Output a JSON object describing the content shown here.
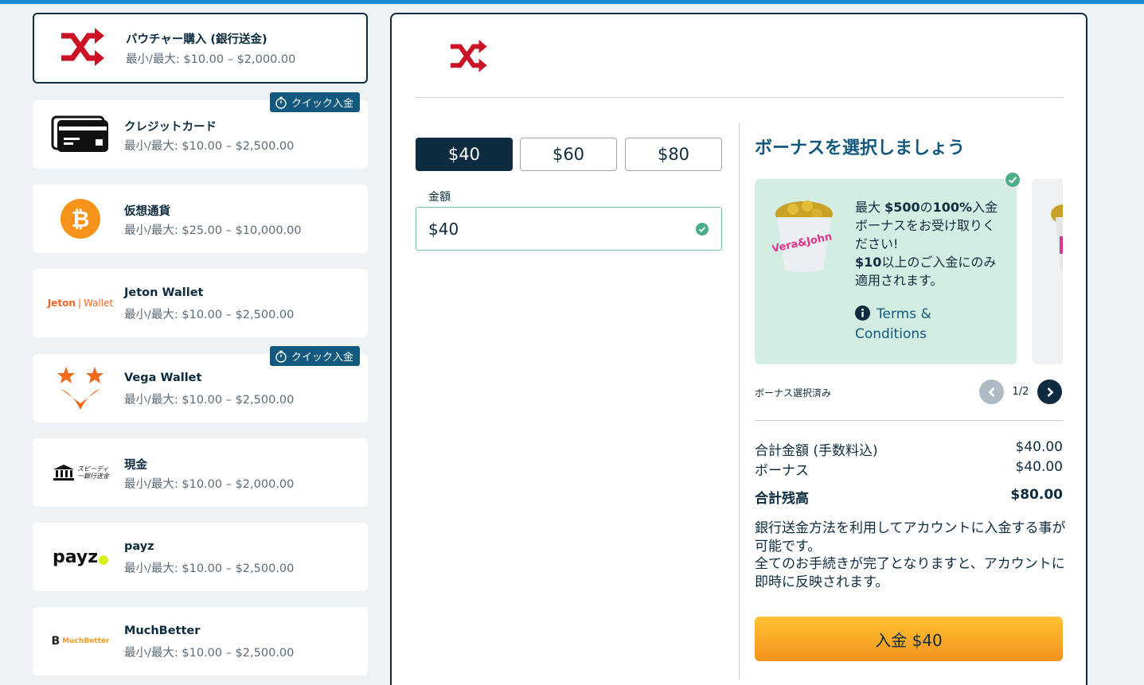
{
  "methods": [
    {
      "name": "バウチャー購入 (銀行送金)",
      "limit": "最小/最大: $10.00 – $2,000.00",
      "icon": "shuffle-icon",
      "selected": true
    },
    {
      "name": "クレジットカード",
      "limit": "最小/最大: $10.00 – $2,500.00",
      "icon": "credit-card-icon",
      "badge": "クイック入金"
    },
    {
      "name": "仮想通貨",
      "limit": "最小/最大: $25.00 – $10,000.00",
      "icon": "bitcoin-icon"
    },
    {
      "name": "Jeton Wallet",
      "limit": "最小/最大: $10.00 – $2,500.00",
      "icon": "jeton-wallet-logo",
      "logo_text_a": "Jeton",
      "logo_text_b": "Wallet"
    },
    {
      "name": "Vega Wallet",
      "limit": "最小/最大: $10.00 – $2,500.00",
      "icon": "vega-wallet-logo",
      "badge": "クイック入金"
    },
    {
      "name": "現金",
      "limit": "最小/最大: $10.00 – $2,000.00",
      "icon": "speedy-bank-transfer-logo",
      "logo_text": "スピーディー銀行送金"
    },
    {
      "name": "payz",
      "limit": "最小/最大: $10.00 – $2,500.00",
      "icon": "payz-logo",
      "logo_text": "payz"
    },
    {
      "name": "MuchBetter",
      "limit": "最小/最大: $10.00 – $2,500.00",
      "icon": "muchbetter-logo",
      "logo_text": "MuchBetter"
    }
  ],
  "amounts": [
    "$40",
    "$60",
    "$80"
  ],
  "amount_label": "金額",
  "amount_value": "$40",
  "bonus": {
    "title": "ボーナスを選択しましょう",
    "line_pre": "最大 ",
    "line_bold1": "$500",
    "line_mid": "の",
    "line_bold2": "100%",
    "line_post": "入金ボーナスをお受け取りください!",
    "line2_bold": "$10",
    "line2_post": "以上のご入金にのみ適用されます。",
    "terms": "Terms & Conditions",
    "selected_label": "ボーナス選択済み",
    "page": "1/2",
    "image_text": "Vera&John"
  },
  "summary": {
    "total_label": "合計金額 (手数料込)",
    "total_value": "$40.00",
    "bonus_label": "ボーナス",
    "bonus_value": "$40.00",
    "balance_label": "合計残高",
    "balance_value": "$80.00"
  },
  "description_1": "銀行送金方法を利用してアカウントに入金する事が可能です。",
  "description_2": "全てのお手続きが完了となりますと、アカウントに即時に反映されます。",
  "deposit_button": "入金 $40",
  "colors": {
    "primary": "#0d2c40",
    "accent": "#13597f",
    "bonus_bg": "#d4ede3",
    "deposit": "#f8a928",
    "shuffle": "#cc1125"
  }
}
